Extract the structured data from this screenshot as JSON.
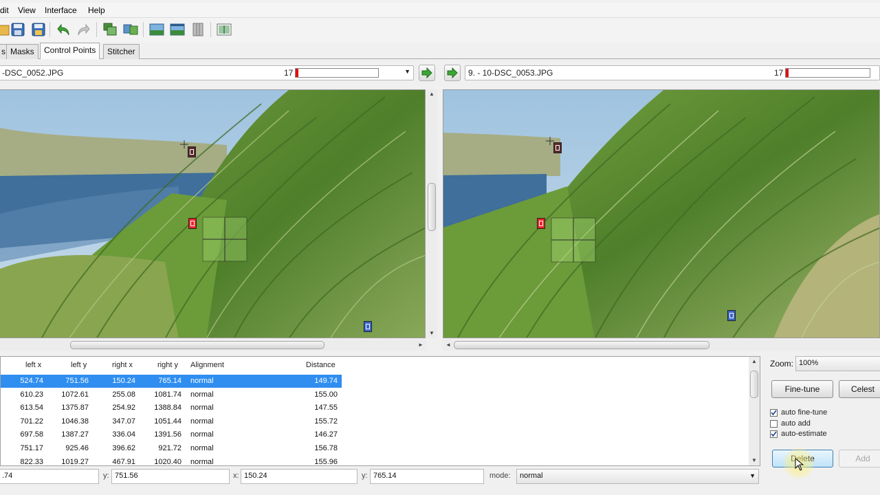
{
  "menu": [
    "dit",
    "View",
    "Interface",
    "Help"
  ],
  "tabs": [
    {
      "label": "s",
      "active": false
    },
    {
      "label": "Masks",
      "active": false
    },
    {
      "label": "Control Points",
      "active": true
    },
    {
      "label": "Stitcher",
      "active": false
    }
  ],
  "left_image": {
    "name": "-DSC_0052.JPG",
    "count": "17",
    "progress_fraction": 0.03
  },
  "right_image": {
    "name": "9. - 10-DSC_0053.JPG",
    "count": "17",
    "progress_fraction": 0.03
  },
  "table": {
    "headers": [
      "left x",
      "left y",
      "right x",
      "right y",
      "Alignment",
      "Distance"
    ],
    "rows": [
      [
        "524.74",
        "751.56",
        "150.24",
        "765.14",
        "normal",
        "149.74"
      ],
      [
        "610.23",
        "1072.61",
        "255.08",
        "1081.74",
        "normal",
        "155.00"
      ],
      [
        "613.54",
        "1375.87",
        "254.92",
        "1388.84",
        "normal",
        "147.55"
      ],
      [
        "701.22",
        "1046.38",
        "347.07",
        "1051.44",
        "normal",
        "155.72"
      ],
      [
        "697.58",
        "1387.27",
        "336.04",
        "1391.56",
        "normal",
        "146.27"
      ],
      [
        "751.17",
        "925.46",
        "396.62",
        "921.72",
        "normal",
        "156.78"
      ],
      [
        "822.33",
        "1019.27",
        "467.91",
        "1020.40",
        "normal",
        "155.96"
      ]
    ],
    "selected_row": 0
  },
  "edit": {
    "x_label": "x:",
    "x_value": ".74",
    "y_label": "y:",
    "y_value": "751.56",
    "x2_label": "x:",
    "x2_value": "150.24",
    "y2_label": "y:",
    "y2_value": "765.14",
    "mode_label": "mode:",
    "mode_value": "normal"
  },
  "right_panel": {
    "zoom_label": "Zoom:",
    "zoom_value": "100%",
    "finetune_label": "Fine-tune",
    "celeste_label": "Celest",
    "checks": [
      {
        "label": "auto fine-tune",
        "checked": true
      },
      {
        "label": "auto add",
        "checked": false
      },
      {
        "label": "auto-estimate",
        "checked": true
      }
    ],
    "delete_label": "Delete",
    "add_label": "Add"
  },
  "marker_labels": {
    "dark": "15",
    "red": "0",
    "blue": "9"
  },
  "colors": {
    "selection": "#2f8ef0",
    "progress": "#e01010",
    "arrow_green": "#3ea437",
    "marker_red": "#e8262a",
    "marker_blue": "#3a66c8",
    "marker_dark": "#5a2a2a"
  },
  "icons": [
    "open-project-icon",
    "save-icon",
    "save-as-icon",
    "undo-icon",
    "redo-icon",
    "add-images-icon",
    "control-point-detect-icon",
    "preview-icon",
    "fast-preview-icon",
    "layout-icon",
    "gl-preview-icon",
    "arrow-right-icon",
    "arrow-left-icon"
  ]
}
